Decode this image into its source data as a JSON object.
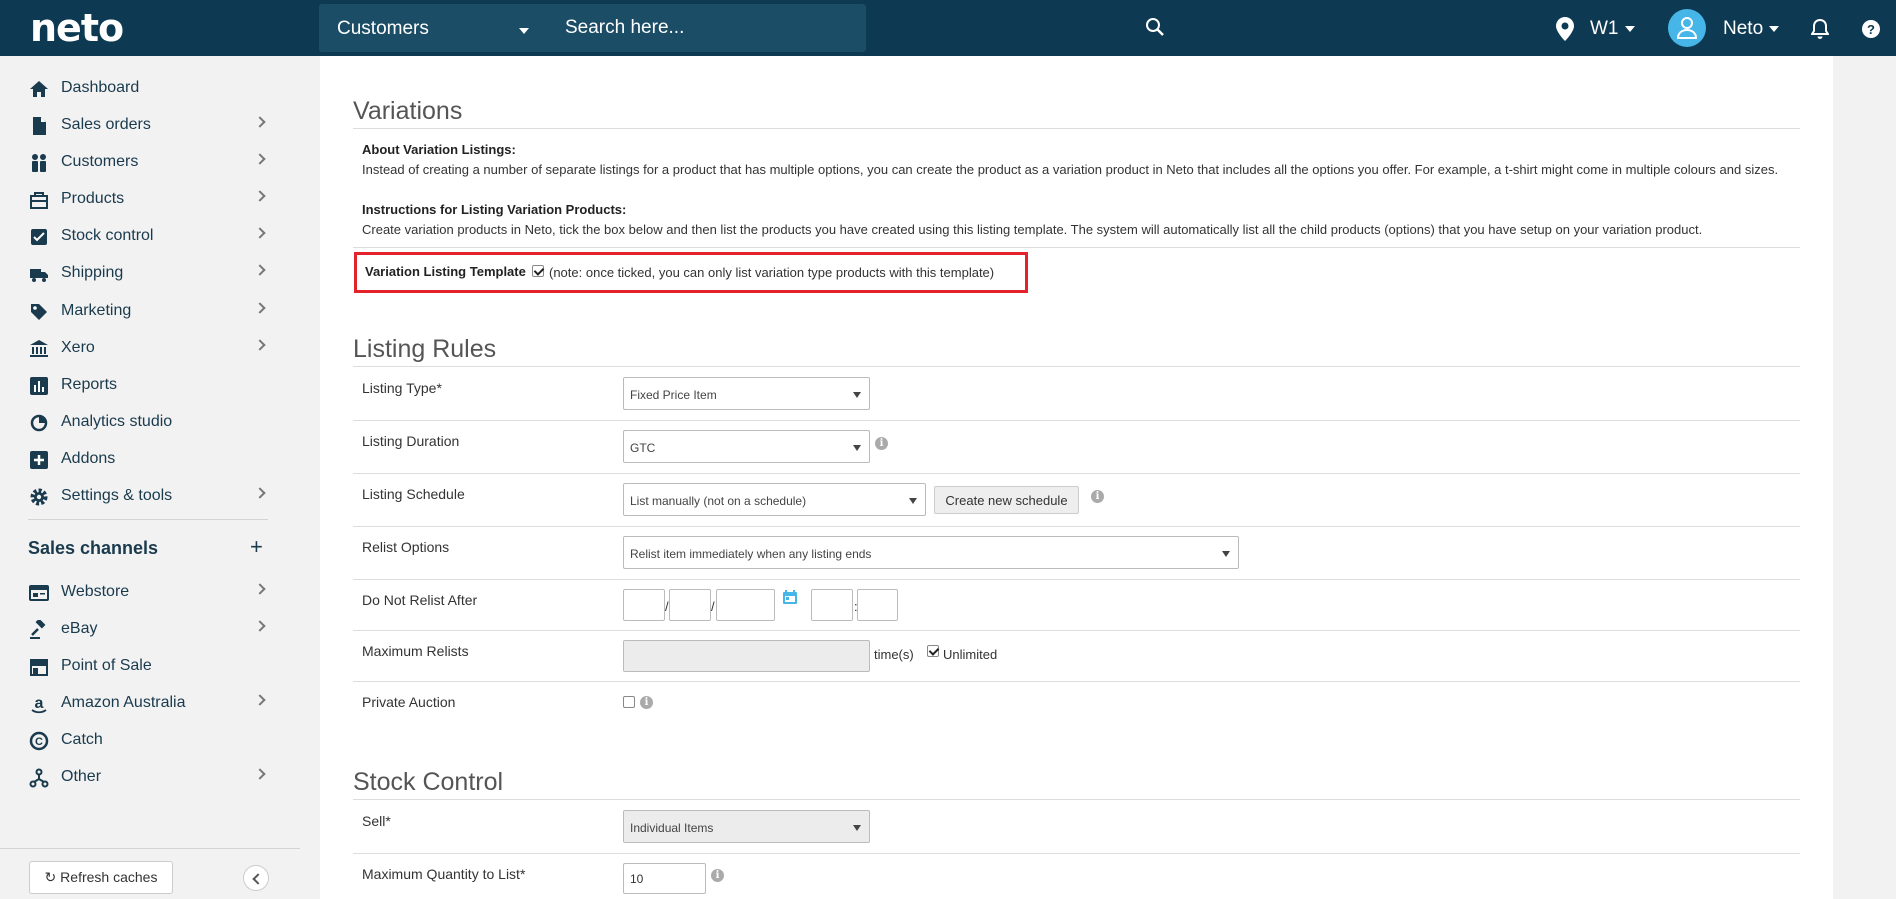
{
  "topbar": {
    "logo": "neto",
    "search_scope": "Customers",
    "search_placeholder": "Search here...",
    "location": "W1",
    "user": "Neto"
  },
  "sidebar": {
    "items": [
      {
        "label": "Dashboard",
        "icon": "home-icon",
        "chevron": false
      },
      {
        "label": "Sales orders",
        "icon": "document-icon",
        "chevron": true
      },
      {
        "label": "Customers",
        "icon": "people-icon",
        "chevron": true
      },
      {
        "label": "Products",
        "icon": "box-icon",
        "chevron": true
      },
      {
        "label": "Stock control",
        "icon": "check-square-icon",
        "chevron": true
      },
      {
        "label": "Shipping",
        "icon": "truck-icon",
        "chevron": true
      },
      {
        "label": "Marketing",
        "icon": "tag-icon",
        "chevron": true
      },
      {
        "label": "Xero",
        "icon": "bank-icon",
        "chevron": true
      },
      {
        "label": "Reports",
        "icon": "bar-chart-icon",
        "chevron": false
      },
      {
        "label": "Analytics studio",
        "icon": "analytics-icon",
        "chevron": false
      },
      {
        "label": "Addons",
        "icon": "plus-square-icon",
        "chevron": false
      },
      {
        "label": "Settings & tools",
        "icon": "gear-icon",
        "chevron": true
      }
    ],
    "channels_title": "Sales channels",
    "channels_add": "+",
    "channels": [
      {
        "label": "Webstore",
        "icon": "browser-icon",
        "chevron": true
      },
      {
        "label": "eBay",
        "icon": "gavel-icon",
        "chevron": true
      },
      {
        "label": "Point of Sale",
        "icon": "store-icon",
        "chevron": false
      },
      {
        "label": "Amazon Australia",
        "icon": "amazon-icon",
        "chevron": true
      },
      {
        "label": "Catch",
        "icon": "catch-icon",
        "chevron": false
      },
      {
        "label": "Other",
        "icon": "network-icon",
        "chevron": true
      }
    ],
    "refresh_label": "Refresh caches"
  },
  "variations": {
    "title": "Variations",
    "about_heading": "About Variation Listings:",
    "about_text": "Instead of creating a number of separate listings for a product that has multiple options, you can create the product as a variation product in Neto that includes all the options you offer. For example, a t-shirt might come in multiple colours and sizes.",
    "instructions_heading": "Instructions for Listing Variation Products:",
    "instructions_text": "Create variation products in Neto, tick the box below and then list the products you have created using this listing template. The system will automatically list all the child products (options) that you have setup on your variation product.",
    "template_label": "Variation Listing Template",
    "template_checked": true,
    "template_note": "(note: once ticked, you can only list variation type products with this template)"
  },
  "listing_rules": {
    "title": "Listing Rules",
    "listing_type_label": "Listing Type*",
    "listing_type_value": "Fixed Price Item",
    "listing_duration_label": "Listing Duration",
    "listing_duration_value": "GTC",
    "listing_schedule_label": "Listing Schedule",
    "listing_schedule_value": "List manually (not on a schedule)",
    "create_schedule_label": "Create new schedule",
    "relist_options_label": "Relist Options",
    "relist_options_value": "Relist item immediately when any listing ends",
    "do_not_relist_label": "Do Not Relist After",
    "date_sep": "/",
    "time_sep": ":",
    "max_relists_label": "Maximum Relists",
    "times_label": "time(s)",
    "unlimited_label": "Unlimited",
    "unlimited_checked": true,
    "private_auction_label": "Private Auction",
    "private_auction_checked": false
  },
  "stock_control": {
    "title": "Stock Control",
    "sell_label": "Sell*",
    "sell_value": "Individual Items",
    "max_qty_label": "Maximum Quantity to List*",
    "max_qty_value": "10"
  }
}
